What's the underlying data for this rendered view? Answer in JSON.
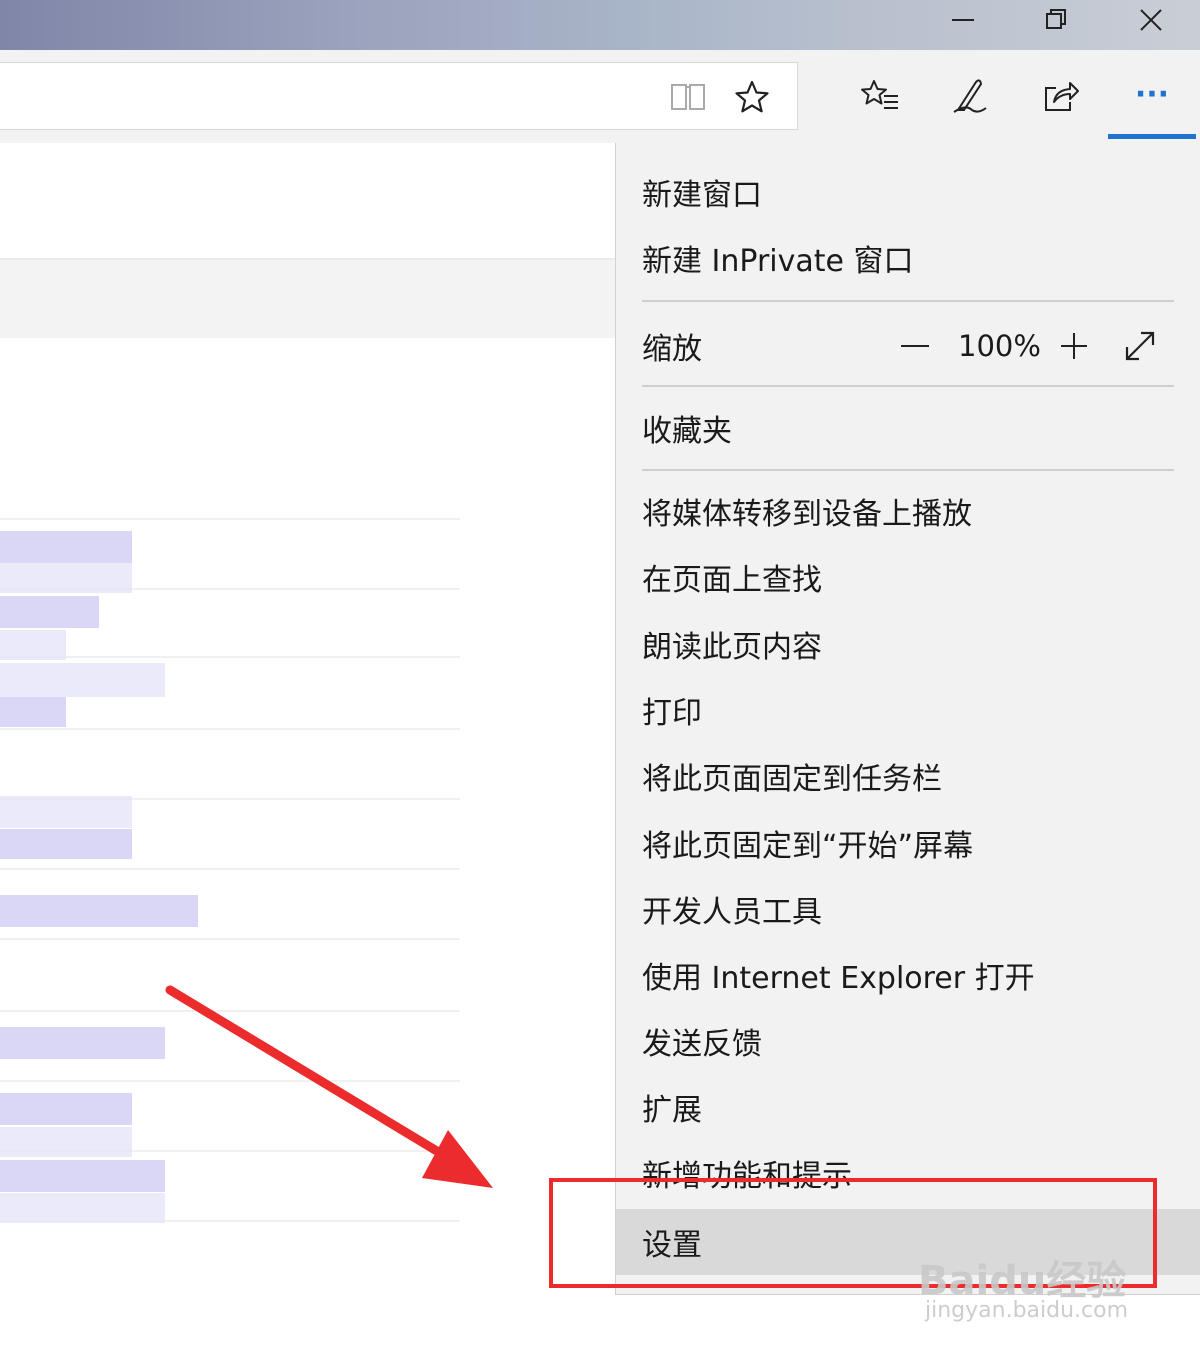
{
  "window": {
    "minimize_glyph": "—",
    "restore_glyph": "❐",
    "close_glyph": "✕"
  },
  "toolbar": {
    "icons": [
      "reading-view-icon",
      "favorite-star-icon",
      "favorites-hub-icon",
      "web-note-pen-icon",
      "share-icon",
      "more-actions-icon"
    ],
    "more_label": "···"
  },
  "menu": {
    "items": [
      {
        "label": "新建窗口"
      },
      {
        "label": "新建 InPrivate 窗口"
      },
      {
        "label": "缩放"
      },
      {
        "label": "收藏夹"
      },
      {
        "label": "将媒体转移到设备上播放"
      },
      {
        "label": "在页面上查找"
      },
      {
        "label": "朗读此页内容"
      },
      {
        "label": "打印"
      },
      {
        "label": "将此页面固定到任务栏"
      },
      {
        "label": "将此页固定到“开始”屏幕"
      },
      {
        "label": "开发人员工具"
      },
      {
        "label": "使用 Internet Explorer 打开"
      },
      {
        "label": "发送反馈"
      },
      {
        "label": "扩展"
      },
      {
        "label": "新增功能和提示"
      },
      {
        "label": "设置",
        "selected": true
      }
    ],
    "zoom": {
      "minus": "—",
      "value": "100%",
      "plus": "+",
      "fullscreen_icon": "fullscreen-icon"
    }
  },
  "annotation": {
    "highlight_color": "#ec2c2c",
    "watermark": "Baidu经验",
    "watermark_sub": "jingyan.baidu.com"
  },
  "colors": {
    "accent": "#1e73d0",
    "menu_bg": "#f2f2f2",
    "selected_bg": "#d9d9d9"
  }
}
